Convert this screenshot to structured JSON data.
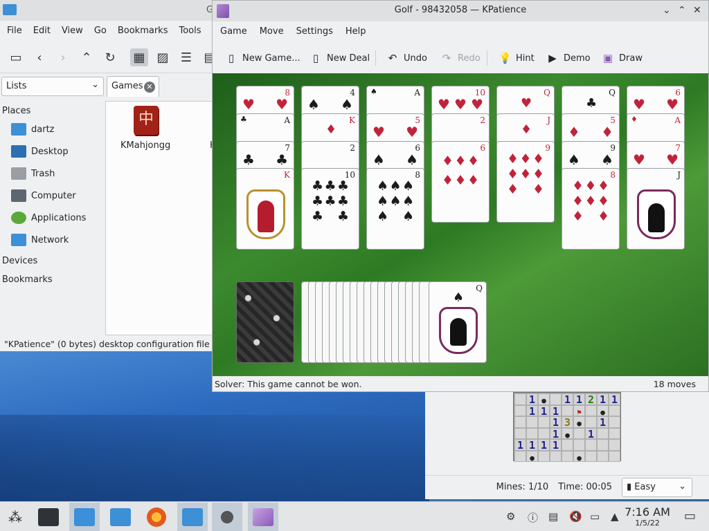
{
  "dolphin": {
    "title_fragment": "G",
    "menu": [
      "File",
      "Edit",
      "View",
      "Go",
      "Bookmarks",
      "Tools"
    ],
    "lists_combo": "Lists",
    "tab_label": "Games",
    "places_header": "Places",
    "places": [
      "dartz",
      "Desktop",
      "Trash",
      "Computer",
      "Applications",
      "Network"
    ],
    "devices_header": "Devices",
    "bookmarks_header": "Bookmarks",
    "file_label": "KMahjongg",
    "file_label_cut": "K",
    "status": "\"KPatience\" (0 bytes) desktop configuration file"
  },
  "kpatience": {
    "title": "Golf - 98432058 — KPatience",
    "menu": [
      "Game",
      "Move",
      "Settings",
      "Help"
    ],
    "toolbar": {
      "new_game": "New Game...",
      "new_deal": "New Deal",
      "undo": "Undo",
      "redo": "Redo",
      "hint": "Hint",
      "demo": "Demo",
      "draw": "Draw"
    },
    "status_left": "Solver: This game cannot be won.",
    "status_right": "18 moves"
  },
  "mines": {
    "rows": [
      [
        "",
        "1",
        "b",
        "",
        "1",
        "1",
        "2",
        "1",
        "1"
      ],
      [
        "",
        "1",
        "1",
        "1",
        "",
        "f",
        "",
        "b",
        ""
      ],
      [
        "",
        "",
        "",
        "1",
        "3",
        "b",
        "",
        "1",
        ""
      ],
      [
        "",
        "",
        "",
        "1",
        "b",
        "",
        "1",
        "",
        ""
      ],
      [
        "1",
        "1",
        "1",
        "1",
        "",
        "",
        "",
        "",
        ""
      ],
      [
        "",
        "b",
        "",
        "",
        "",
        "b",
        "",
        "",
        ""
      ]
    ],
    "mines_label": "Mines: 1/10",
    "time_label": "Time: 00:05",
    "difficulty": "Easy"
  },
  "taskbar": {
    "clock_time": "7:16 AM",
    "clock_date": "1/5/22"
  }
}
